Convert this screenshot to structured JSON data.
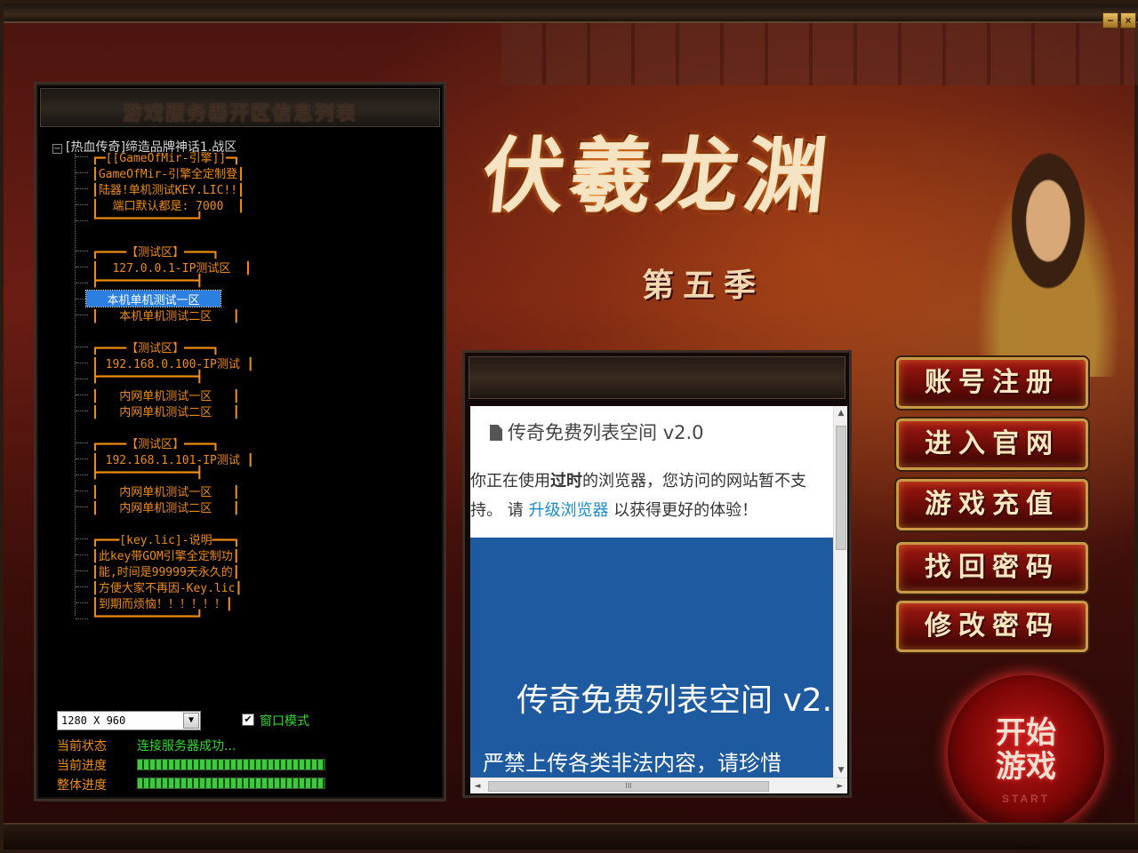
{
  "window": {
    "minimize_label": "−",
    "close_label": "×"
  },
  "server_panel": {
    "title": "游戏服务器开区信息列表",
    "root_label": "[热血传奇]缔造品牌神话1.战区",
    "root_expander": "−",
    "items": [
      {
        "text": "┏━[[GameOfMir-引擎]]━┓"
      },
      {
        "text": "┃GameOfMir-引擎全定制登┃"
      },
      {
        "text": "┃陆器!单机测试KEY.LIC!!┃"
      },
      {
        "text": "┃  端口默认都是: 7000  ┃"
      },
      {
        "text": "┗━━━━━━━━━━━━━━┛"
      },
      {
        "text": "┏━━━━【测试区】━━━━┓"
      },
      {
        "text": "┃  127.0.0.1-IP测试区  ┃"
      },
      {
        "text": "┣━━━━━━━━━━━━━━┫"
      },
      {
        "text": "   本机单机测试一区   ",
        "selected": true
      },
      {
        "text": "┃   本机单机测试二区   ┃"
      },
      {
        "text": "┏━━━━【测试区】━━━━┓"
      },
      {
        "text": "┃ 192.168.0.100-IP测试 ┃"
      },
      {
        "text": "┣━━━━━━━━━━━━━━┫"
      },
      {
        "text": "┃   内网单机测试一区   ┃"
      },
      {
        "text": "┃   内网单机测试二区   ┃"
      },
      {
        "text": "┏━━━━【测试区】━━━━┓"
      },
      {
        "text": "┃ 192.168.1.101-IP测试 ┃"
      },
      {
        "text": "┣━━━━━━━━━━━━━━┫"
      },
      {
        "text": "┃   内网单机测试一区   ┃"
      },
      {
        "text": "┃   内网单机测试二区   ┃"
      },
      {
        "text": "┏━━━[key.lic]-说明━━━┓"
      },
      {
        "text": "┃此key带GOM引擎全定制功┃"
      },
      {
        "text": "┃能,时间是99999天永久的┃"
      },
      {
        "text": "┃方便大家不再因-Key.lic┃"
      },
      {
        "text": "┃到期而烦恼！！！！！！┃"
      },
      {
        "text": "┗━━━━━━━━━━━━━━┛"
      }
    ]
  },
  "settings": {
    "resolution_value": "1280 X 960",
    "resolution_arrow": "▼",
    "window_mode_checked": "✔",
    "window_mode_label": "窗口模式"
  },
  "status": {
    "current_status_label": "当前状态",
    "current_status_value": "连接服务器成功...",
    "current_progress_label": "当前进度",
    "overall_progress_label": "整体进度",
    "current_progress_percent": 100,
    "overall_progress_percent": 100
  },
  "browser": {
    "site_title": "传奇免费列表空间",
    "site_version": "v2.0",
    "warning_prefix": "你正在使用",
    "warning_bold": "过时",
    "warning_middle": "的浏览器，您访问的网站暂不支持。 请 ",
    "warning_link": "升级浏览器",
    "warning_suffix": " 以获得更好的体验！",
    "hero_title": "传奇免费列表空间 v2.",
    "hero_sub": "严禁上传各类非法内容，请珍惜",
    "scroll_up": "▲",
    "scroll_down": "▼",
    "scroll_left": "◄",
    "scroll_right": "►",
    "hscroll_grip": "III"
  },
  "logo": {
    "title": "伏羲龙渊",
    "subtitle": "第五季"
  },
  "menu": {
    "register": "账号注册",
    "website": "进入官网",
    "recharge": "游戏充值",
    "recover_password": "找回密码",
    "change_password": "修改密码"
  },
  "start": {
    "label_line1": "开始",
    "label_line2": "游戏",
    "label_en": "START"
  }
}
